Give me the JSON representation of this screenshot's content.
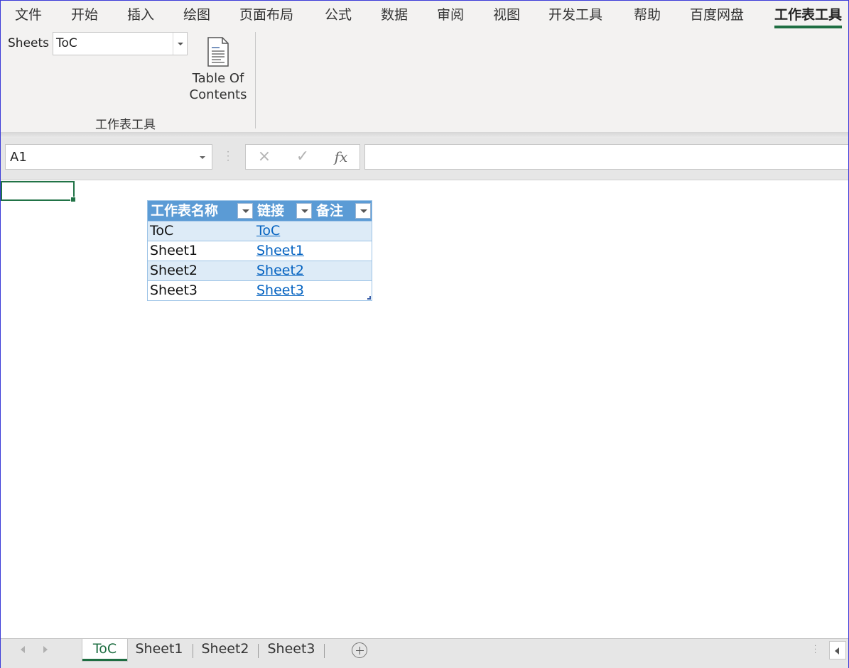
{
  "ribbon_tabs": [
    "文件",
    "开始",
    "插入",
    "绘图",
    "页面布局",
    "公式",
    "数据",
    "审阅",
    "视图",
    "开发工具",
    "帮助",
    "百度网盘",
    "工作表工具"
  ],
  "active_ribbon_tab": "工作表工具",
  "ribbon": {
    "sheets_label": "Sheets",
    "sheets_selected": "ToC",
    "toc_button_line1": "Table Of",
    "toc_button_line2": "Contents",
    "toc_button_icon": "document-icon",
    "group_label": "工作表工具"
  },
  "formula_bar": {
    "name_box": "A1",
    "cancel_icon": "×",
    "enter_icon": "✓",
    "fx_label": "fx",
    "formula_value": ""
  },
  "table": {
    "headers": [
      "工作表名称",
      "链接",
      "备注"
    ],
    "rows": [
      {
        "name": "ToC",
        "link": "ToC",
        "note": ""
      },
      {
        "name": "Sheet1",
        "link": "Sheet1",
        "note": ""
      },
      {
        "name": "Sheet2",
        "link": "Sheet2",
        "note": ""
      },
      {
        "name": "Sheet3",
        "link": "Sheet3",
        "note": ""
      }
    ]
  },
  "sheet_tabs": [
    "ToC",
    "Sheet1",
    "Sheet2",
    "Sheet3"
  ],
  "active_sheet": "ToC",
  "colors": {
    "accent_green": "#217346",
    "table_header": "#5b9bd5",
    "table_band": "#ddebf7",
    "link": "#0563c1"
  }
}
